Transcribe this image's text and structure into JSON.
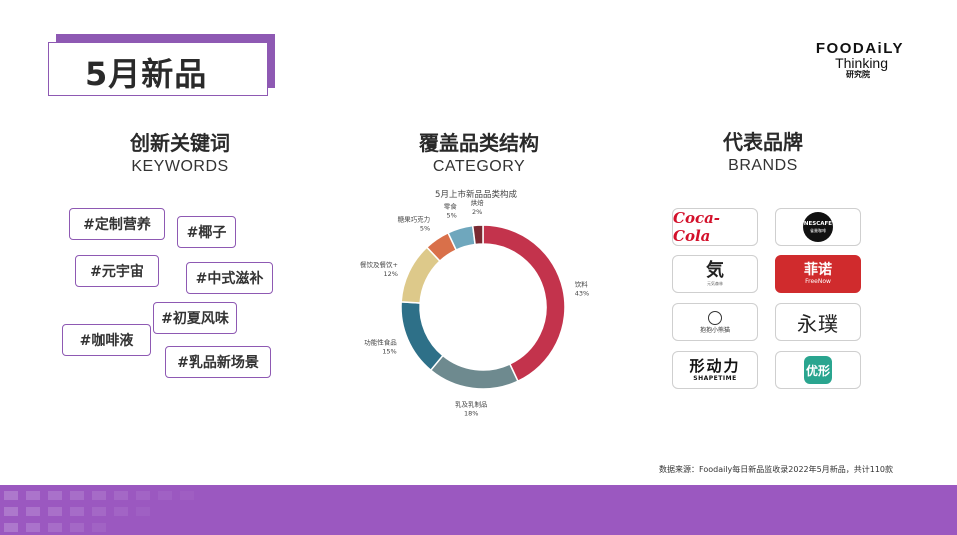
{
  "page": {
    "title": "5月新品",
    "source": "数据来源：Foodaily每日新品监收录2022年5月新品，共计110款"
  },
  "logo": {
    "line1": "FOODAiLY",
    "line2": "Thinking",
    "line3": "研究院"
  },
  "sections": {
    "keywords": {
      "cn": "创新关键词",
      "en": "KEYWORDS"
    },
    "category": {
      "cn": "覆盖品类结构",
      "en": "CATEGORY"
    },
    "brands": {
      "cn": "代表品牌",
      "en": "BRANDS"
    }
  },
  "keywords": [
    "#定制营养",
    "#椰子",
    "#元宇宙",
    "#中式滋补",
    "#初夏风味",
    "#咖啡液",
    "#乳品新场景"
  ],
  "chart_data": {
    "type": "pie",
    "title": "5月上市新品品类构成",
    "categories": [
      "饮料",
      "乳及乳制品",
      "功能性食品",
      "餐饮及餐饮+",
      "糖果巧克力",
      "零食",
      "烘焙"
    ],
    "values": [
      43,
      18,
      15,
      12,
      5,
      5,
      2
    ],
    "labels": [
      "43%",
      "18%",
      "15%",
      "12%",
      "5%",
      "5%",
      "2%"
    ],
    "colors": [
      "#c3334c",
      "#6e8a8f",
      "#2e7088",
      "#ddc98a",
      "#d9704a",
      "#6fa7bd",
      "#7a2a32"
    ],
    "donut": true
  },
  "brands": [
    {
      "name": "Coca-Cola",
      "icon": "coca-cola-logo"
    },
    {
      "name": "NESCAFE",
      "sub": "雀巢咖啡",
      "icon": "nescafe-logo"
    },
    {
      "name": "気",
      "sub": "元気森林",
      "icon": "genki-forest-logo"
    },
    {
      "name": "菲诺",
      "sub": "FreeNow",
      "icon": "freenow-logo"
    },
    {
      "name": "抱抱小熊猫",
      "icon": "panda-brand-logo"
    },
    {
      "name": "永璞",
      "icon": "yongpu-logo"
    },
    {
      "name": "形动力",
      "sub": "SHAPETIME",
      "icon": "shapetime-logo"
    },
    {
      "name": "优形",
      "icon": "youxing-logo"
    }
  ],
  "colors": {
    "accent": "#8e59b3",
    "footer": "#9b58c0"
  }
}
